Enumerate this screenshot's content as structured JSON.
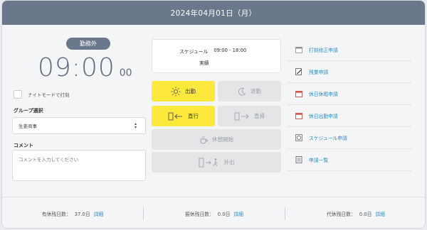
{
  "header": {
    "date": "2024年04月01日（月）"
  },
  "left": {
    "status_badge": "勤務外",
    "clock_hm": "09:00",
    "clock_sec": "00",
    "night_mode_label": "ナイトモードで打刻",
    "group_label": "グループ選択",
    "group_value": "生姜商事",
    "comment_label": "コメント",
    "comment_placeholder": "コメントを入力してください"
  },
  "schedule": {
    "label": "スケジュール",
    "time": "09:00 - 18:00",
    "actual_label": "実績"
  },
  "buttons": {
    "clock_in": "出勤",
    "clock_out": "退勤",
    "direct_go": "直行",
    "direct_return": "直帰",
    "break_start": "休憩開始",
    "go_out": "外出"
  },
  "links": [
    {
      "label": "打刻修正申請",
      "icon": "calendar-icon"
    },
    {
      "label": "残業申請",
      "icon": "pencil-icon"
    },
    {
      "label": "休日休暇申請",
      "icon": "calendar-icon"
    },
    {
      "label": "休日出勤申請",
      "icon": "calendar-icon"
    },
    {
      "label": "スケジュール申請",
      "icon": "schedule-icon"
    },
    {
      "label": "申請一覧",
      "icon": "list-icon"
    }
  ],
  "footer": {
    "paid_leave_label": "有休残日数：",
    "paid_leave_value": "37.0日",
    "substitute_label": "振休残日数：",
    "substitute_value": "0.0日",
    "compensatory_label": "代休残日数：",
    "compensatory_value": "0.0日",
    "detail_label": "詳細"
  },
  "colors": {
    "header": "#6b778a",
    "active_button": "#fde93c",
    "link": "#2a8ec7"
  }
}
